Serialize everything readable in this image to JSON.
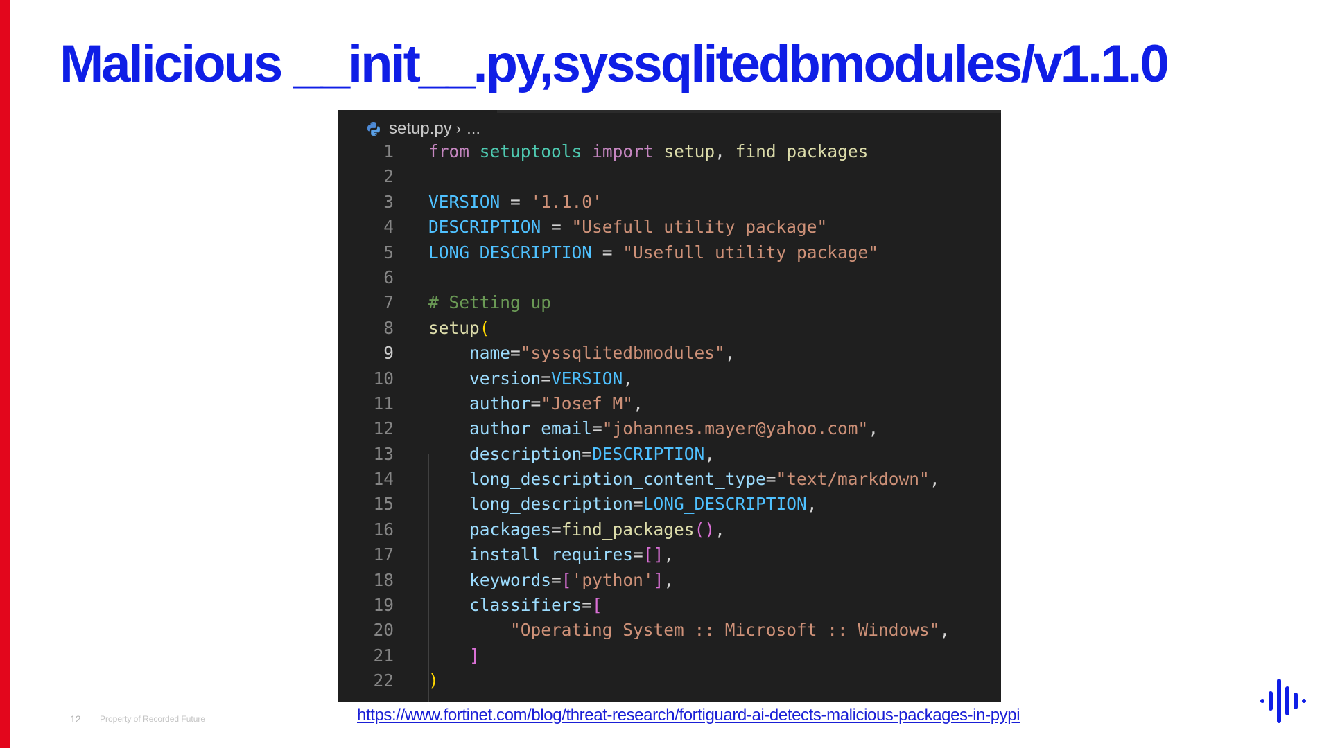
{
  "slide": {
    "title": "Malicious __init__.py,syssqlitedbmodules/v1.1.0",
    "page_number": "12",
    "footer_text": "Property of Recorded Future",
    "source_link": "https://www.fortinet.com/blog/threat-research/fortiguard-ai-detects-malicious-packages-in-pypi",
    "accent_color": "#e3061c",
    "title_color": "#0f1ee6",
    "logo_icon": "recorded-future-logo-icon"
  },
  "editor": {
    "file_icon": "python-icon",
    "filename": "setup.py",
    "breadcrumb_separator": "›",
    "breadcrumb_rest": "...",
    "active_line": "9",
    "background_color": "#1f1f1f",
    "lines": [
      {
        "n": "1",
        "tokens": [
          {
            "t": "from",
            "c": "k-import"
          },
          {
            "t": " ",
            "c": "k-punc"
          },
          {
            "t": "setuptools",
            "c": "k-mod"
          },
          {
            "t": " ",
            "c": "k-punc"
          },
          {
            "t": "import",
            "c": "k-import"
          },
          {
            "t": " ",
            "c": "k-punc"
          },
          {
            "t": "setup",
            "c": "k-fn"
          },
          {
            "t": ", ",
            "c": "k-punc"
          },
          {
            "t": "find_packages",
            "c": "k-fn"
          }
        ]
      },
      {
        "n": "2",
        "tokens": []
      },
      {
        "n": "3",
        "tokens": [
          {
            "t": "VERSION",
            "c": "k-const"
          },
          {
            "t": " = ",
            "c": "k-punc"
          },
          {
            "t": "'1.1.0'",
            "c": "k-str"
          }
        ]
      },
      {
        "n": "4",
        "tokens": [
          {
            "t": "DESCRIPTION",
            "c": "k-const"
          },
          {
            "t": " = ",
            "c": "k-punc"
          },
          {
            "t": "\"Usefull utility package\"",
            "c": "k-str"
          }
        ]
      },
      {
        "n": "5",
        "tokens": [
          {
            "t": "LONG_DESCRIPTION",
            "c": "k-const"
          },
          {
            "t": " = ",
            "c": "k-punc"
          },
          {
            "t": "\"Usefull utility package\"",
            "c": "k-str"
          }
        ]
      },
      {
        "n": "6",
        "tokens": []
      },
      {
        "n": "7",
        "tokens": [
          {
            "t": "# Setting up",
            "c": "k-comment"
          }
        ]
      },
      {
        "n": "8",
        "tokens": [
          {
            "t": "setup",
            "c": "k-fn"
          },
          {
            "t": "(",
            "c": "k-p1"
          }
        ]
      },
      {
        "n": "9",
        "tokens": [
          {
            "t": "    ",
            "c": "k-punc"
          },
          {
            "t": "name",
            "c": "k-var"
          },
          {
            "t": "=",
            "c": "k-punc"
          },
          {
            "t": "\"syssqlitedbmodules\"",
            "c": "k-str"
          },
          {
            "t": ",",
            "c": "k-punc"
          }
        ]
      },
      {
        "n": "10",
        "tokens": [
          {
            "t": "    ",
            "c": "k-punc"
          },
          {
            "t": "version",
            "c": "k-var"
          },
          {
            "t": "=",
            "c": "k-punc"
          },
          {
            "t": "VERSION",
            "c": "k-const"
          },
          {
            "t": ",",
            "c": "k-punc"
          }
        ]
      },
      {
        "n": "11",
        "tokens": [
          {
            "t": "    ",
            "c": "k-punc"
          },
          {
            "t": "author",
            "c": "k-var"
          },
          {
            "t": "=",
            "c": "k-punc"
          },
          {
            "t": "\"Josef M\"",
            "c": "k-str"
          },
          {
            "t": ",",
            "c": "k-punc"
          }
        ]
      },
      {
        "n": "12",
        "tokens": [
          {
            "t": "    ",
            "c": "k-punc"
          },
          {
            "t": "author_email",
            "c": "k-var"
          },
          {
            "t": "=",
            "c": "k-punc"
          },
          {
            "t": "\"johannes.mayer@yahoo.com\"",
            "c": "k-str"
          },
          {
            "t": ",",
            "c": "k-punc"
          }
        ]
      },
      {
        "n": "13",
        "tokens": [
          {
            "t": "    ",
            "c": "k-punc"
          },
          {
            "t": "description",
            "c": "k-var"
          },
          {
            "t": "=",
            "c": "k-punc"
          },
          {
            "t": "DESCRIPTION",
            "c": "k-const"
          },
          {
            "t": ",",
            "c": "k-punc"
          }
        ]
      },
      {
        "n": "14",
        "tokens": [
          {
            "t": "    ",
            "c": "k-punc"
          },
          {
            "t": "long_description_content_type",
            "c": "k-var"
          },
          {
            "t": "=",
            "c": "k-punc"
          },
          {
            "t": "\"text/markdown\"",
            "c": "k-str"
          },
          {
            "t": ",",
            "c": "k-punc"
          }
        ]
      },
      {
        "n": "15",
        "tokens": [
          {
            "t": "    ",
            "c": "k-punc"
          },
          {
            "t": "long_description",
            "c": "k-var"
          },
          {
            "t": "=",
            "c": "k-punc"
          },
          {
            "t": "LONG_DESCRIPTION",
            "c": "k-const"
          },
          {
            "t": ",",
            "c": "k-punc"
          }
        ]
      },
      {
        "n": "16",
        "tokens": [
          {
            "t": "    ",
            "c": "k-punc"
          },
          {
            "t": "packages",
            "c": "k-var"
          },
          {
            "t": "=",
            "c": "k-punc"
          },
          {
            "t": "find_packages",
            "c": "k-fn"
          },
          {
            "t": "()",
            "c": "k-p2"
          },
          {
            "t": ",",
            "c": "k-punc"
          }
        ]
      },
      {
        "n": "17",
        "tokens": [
          {
            "t": "    ",
            "c": "k-punc"
          },
          {
            "t": "install_requires",
            "c": "k-var"
          },
          {
            "t": "=",
            "c": "k-punc"
          },
          {
            "t": "[]",
            "c": "k-p2"
          },
          {
            "t": ",",
            "c": "k-punc"
          }
        ]
      },
      {
        "n": "18",
        "tokens": [
          {
            "t": "    ",
            "c": "k-punc"
          },
          {
            "t": "keywords",
            "c": "k-var"
          },
          {
            "t": "=",
            "c": "k-punc"
          },
          {
            "t": "[",
            "c": "k-p2"
          },
          {
            "t": "'python'",
            "c": "k-str"
          },
          {
            "t": "]",
            "c": "k-p2"
          },
          {
            "t": ",",
            "c": "k-punc"
          }
        ]
      },
      {
        "n": "19",
        "tokens": [
          {
            "t": "    ",
            "c": "k-punc"
          },
          {
            "t": "classifiers",
            "c": "k-var"
          },
          {
            "t": "=",
            "c": "k-punc"
          },
          {
            "t": "[",
            "c": "k-p2"
          }
        ]
      },
      {
        "n": "20",
        "tokens": [
          {
            "t": "        ",
            "c": "k-punc"
          },
          {
            "t": "\"Operating System :: Microsoft :: Windows\"",
            "c": "k-str"
          },
          {
            "t": ",",
            "c": "k-punc"
          }
        ]
      },
      {
        "n": "21",
        "tokens": [
          {
            "t": "    ",
            "c": "k-punc"
          },
          {
            "t": "]",
            "c": "k-p2"
          }
        ]
      },
      {
        "n": "22",
        "tokens": [
          {
            "t": ")",
            "c": "k-p1"
          }
        ]
      }
    ]
  }
}
